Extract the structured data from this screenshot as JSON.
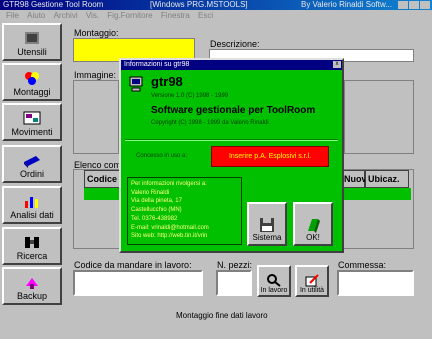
{
  "window": {
    "title_left": "GTR98 Gestione Tool Room",
    "title_mid": "[Windows PRG.MSTOOLS]",
    "title_right": "By Valerio Rinaldi Softw..."
  },
  "toolbar": {
    "items": [
      "File",
      "Aiuto",
      "Archivi",
      "Vis.",
      "Fig.Fornitore",
      "Finestra",
      "Esci"
    ]
  },
  "sidebar": {
    "items": [
      {
        "label": "Utensili",
        "icon": "tools-icon"
      },
      {
        "label": "Montaggi",
        "icon": "assembly-icon"
      },
      {
        "label": "Movimenti",
        "icon": "movements-icon"
      },
      {
        "label": "Ordini",
        "icon": "orders-icon"
      },
      {
        "label": "Analisi dati",
        "icon": "chart-icon"
      },
      {
        "label": "Ricerca",
        "icon": "binoculars-icon"
      },
      {
        "label": "Backup",
        "icon": "backup-icon"
      }
    ]
  },
  "form": {
    "montaggio_label": "Montaggio:",
    "descrizione_label": "Descrizione:",
    "immagine_label": "Immagine:",
    "elenco_label": "Elenco comp...",
    "col_codice": "Codice c...",
    "col_nuovi": "Nuovi",
    "col_ubicaz": "Ubicaz.",
    "codice_label": "Codice da mandare in lavoro:",
    "npezzi_label": "N. pezzi:",
    "commessa_label": "Commessa:",
    "in_lavoro_label": "In lavoro",
    "in_utilita_label": "In utilità",
    "status_text": "Montaggio fine dati lavoro"
  },
  "dialog": {
    "title": "Informazioni su gtr98",
    "app_name": "gtr98",
    "version": "Versione 1.0 (C) 1998 - 1999",
    "product": "Software gestionale per ToolRoom",
    "copyright": "Copyright (C) 1998 - 1999 da Valerio Rinaldi",
    "licensed_label": "Concesso in uso a:",
    "licensed_to": "Inserire p.A. Esplosivi s.r.l.",
    "info_lines": [
      "Per informazioni rivolgersi a:",
      "Valerio Rinaldi",
      "Via della pineta, 17",
      "Castellucchio (MN)",
      "Tel. 0376-438982",
      "E-mail: vrinaldi@hotmail.com",
      "Sito web: http://web.tin.it/vrin"
    ],
    "sistema_label": "Sistema",
    "ok_label": "OK!"
  },
  "colors": {
    "dialog_bg": "#00c000",
    "license_red": "#ff0000",
    "montaggio_field": "#ffff00"
  }
}
